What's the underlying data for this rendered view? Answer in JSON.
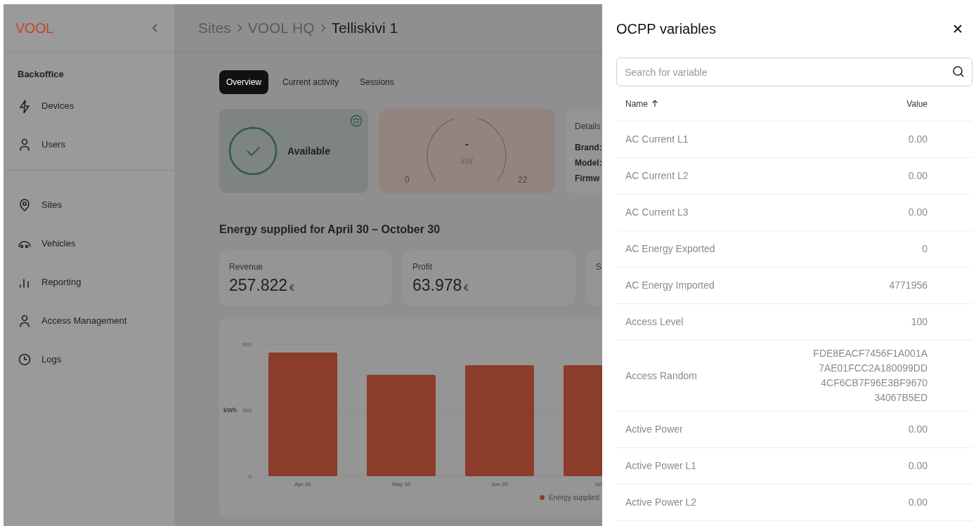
{
  "sidebar": {
    "logo": "VOOL",
    "sections": [
      {
        "title": "Backoffice",
        "items": [
          {
            "label": "Devices"
          },
          {
            "label": "Users"
          }
        ]
      },
      {
        "items": [
          {
            "label": "Sites"
          },
          {
            "label": "Vehicles"
          },
          {
            "label": "Reporting"
          },
          {
            "label": "Access Management"
          },
          {
            "label": "Logs"
          }
        ]
      }
    ]
  },
  "breadcrumbs": [
    "Sites",
    "VOOL HQ",
    "Telliskivi 1"
  ],
  "tabs": [
    {
      "label": "Overview",
      "selected": true
    },
    {
      "label": "Current activity",
      "selected": false
    },
    {
      "label": "Sessions",
      "selected": false
    }
  ],
  "status_card": {
    "label": "Available"
  },
  "gauge_card": {
    "reading": "-",
    "unit": "kW",
    "min": "0",
    "max": "22"
  },
  "details_card": {
    "title": "Details",
    "fields": [
      "Brand:",
      "Model:",
      "Firmw"
    ]
  },
  "energy_title": "Energy supplied for April 30 – October 30",
  "metrics": [
    {
      "label": "Revenue",
      "value": "257.822",
      "unit": "€"
    },
    {
      "label": "Profit",
      "value": "63.978",
      "unit": "€"
    },
    {
      "label": "S"
    }
  ],
  "chart": {
    "chart_data": {
      "type": "bar",
      "ylabel": "kWh",
      "categories": [
        "Apr 30",
        "May 30",
        "Jun 30",
        "Jul"
      ],
      "ylim": [
        0,
        600
      ],
      "yticks": [
        0,
        300,
        600
      ],
      "series": [
        {
          "name": "Energy supplied",
          "color": "#8b3c2a",
          "values": [
            562,
            460,
            504,
            504
          ]
        }
      ]
    }
  },
  "drawer": {
    "title": "OCPP variables",
    "search": {
      "placeholder": "Search for variable"
    },
    "columns": [
      "Name",
      "Value"
    ],
    "rows": [
      {
        "name": "AC Current L1",
        "value_lines": [
          "0.00"
        ]
      },
      {
        "name": "AC Current L2",
        "value_lines": [
          "0.00"
        ]
      },
      {
        "name": "AC Current L3",
        "value_lines": [
          "0.00"
        ]
      },
      {
        "name": "AC Energy Exported",
        "value_lines": [
          "0"
        ]
      },
      {
        "name": "AC Energy Imported",
        "value_lines": [
          "4771956"
        ]
      },
      {
        "name": "Access Level",
        "value_lines": [
          "100"
        ]
      },
      {
        "name": "Access Random",
        "value_lines": [
          "FDE8EACF7456F1A001A",
          "7AE01FCC2A180099DD",
          "4CF6CB7F96E3BF9670",
          "34067B5ED"
        ]
      },
      {
        "name": "Active Power",
        "value_lines": [
          "0.00"
        ]
      },
      {
        "name": "Active Power L1",
        "value_lines": [
          "0.00"
        ]
      },
      {
        "name": "Active Power L2",
        "value_lines": [
          "0.00"
        ]
      }
    ]
  }
}
